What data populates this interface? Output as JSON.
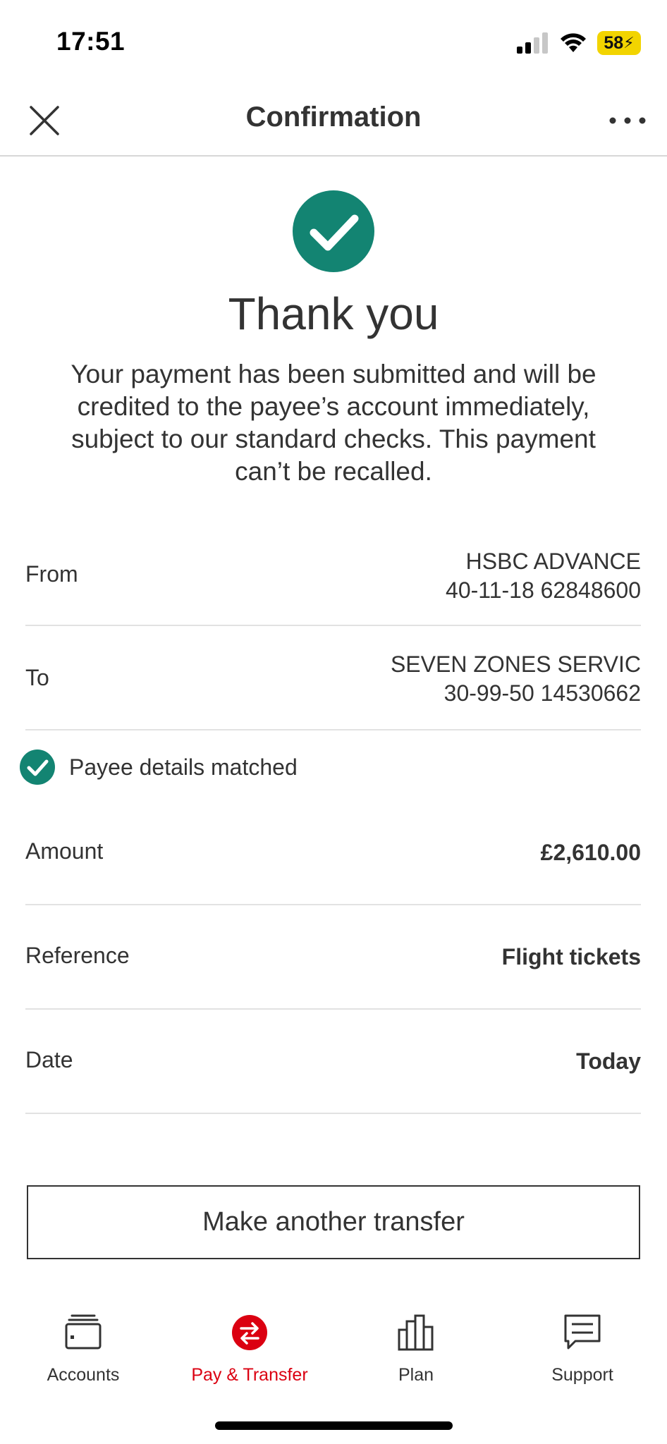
{
  "status_bar": {
    "time": "17:51",
    "battery": "58"
  },
  "header": {
    "title": "Confirmation"
  },
  "success": {
    "title": "Thank you",
    "message": "Your payment has been submitted and will be credited to the payee’s account immediately, subject to our standard checks. This payment can’t be recalled."
  },
  "details": {
    "from": {
      "label": "From",
      "name": "HSBC ADVANCE",
      "account": "40-11-18 62848600"
    },
    "to": {
      "label": "To",
      "name": "SEVEN ZONES SERVIC",
      "account": "30-99-50 14530662"
    },
    "payee_match": "Payee details matched",
    "amount": {
      "label": "Amount",
      "value": "£2,610.00"
    },
    "reference": {
      "label": "Reference",
      "value": "Flight tickets"
    },
    "date": {
      "label": "Date",
      "value": "Today"
    }
  },
  "actions": {
    "another_transfer": "Make another transfer"
  },
  "tabs": [
    {
      "label": "Accounts",
      "icon": "wallet-icon"
    },
    {
      "label": "Pay & Transfer",
      "icon": "transfer-icon",
      "active": true
    },
    {
      "label": "Plan",
      "icon": "bar-chart-icon"
    },
    {
      "label": "Support",
      "icon": "chat-icon"
    }
  ],
  "colors": {
    "success": "#138472",
    "active_tab": "#db0011",
    "battery": "#f2d400"
  }
}
